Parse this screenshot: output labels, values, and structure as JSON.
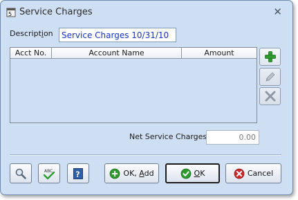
{
  "window": {
    "title": "Service Charges",
    "close_glyph": "✕",
    "app_icon": "app-window-icon"
  },
  "form": {
    "description_label_pre": "Descript",
    "description_label_u": "i",
    "description_label_post": "on",
    "description_value": "Service Charges 10/31/10"
  },
  "grid": {
    "columns": [
      "Acct No.",
      "Account Name",
      "Amount"
    ],
    "rows": []
  },
  "side_buttons": [
    {
      "name": "add-row",
      "icon": "plus-icon",
      "enabled": true
    },
    {
      "name": "edit-row",
      "icon": "pencil-icon",
      "enabled": false
    },
    {
      "name": "delete-row",
      "icon": "x-icon",
      "enabled": false
    }
  ],
  "totals": {
    "net_label": "Net Service Charges",
    "net_value": "0.00"
  },
  "buttons": {
    "ok_add_pre": "OK, ",
    "ok_add_u": "A",
    "ok_add_post": "dd",
    "ok_u": "O",
    "ok_post": "K",
    "cancel_label": "Cancel"
  },
  "colors": {
    "dialog_bg": "#cfdff3",
    "input_text": "#1533c4",
    "plus_green": "#2e9b2e",
    "ok_green": "#2e9b2e",
    "cancel_red": "#cc2a2a"
  }
}
